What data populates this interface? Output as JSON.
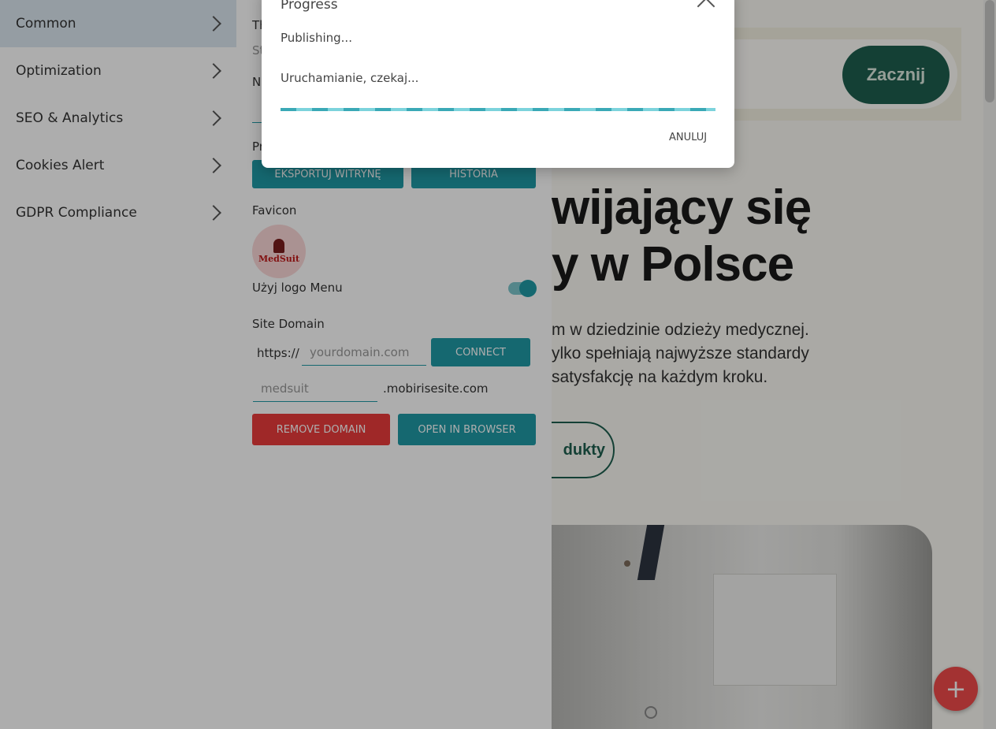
{
  "menu": {
    "items": [
      {
        "label": "Common"
      },
      {
        "label": "Optimization"
      },
      {
        "label": "SEO & Analytics"
      },
      {
        "label": "Cookies Alert"
      },
      {
        "label": "GDPR Compliance"
      }
    ]
  },
  "panel": {
    "partial_labels": [
      "Th",
      "St",
      "N",
      "Pr"
    ],
    "export_button": "EKSPORTUJ WITRYNĘ",
    "history_button": "HISTORIA",
    "favicon_label": "Favicon",
    "favicon_logo_text": "MedSuit",
    "use_logo_label": "Użyj logo Menu",
    "use_logo_enabled": true,
    "site_domain_label": "Site Domain",
    "https_prefix": "https://",
    "domain_placeholder": "yourdomain.com",
    "connect_button": "CONNECT",
    "subdomain_value": "medsuit",
    "subdomain_suffix": ".mobirisesite.com",
    "remove_domain_button": "REMOVE DOMAIN",
    "open_browser_button": "OPEN IN BROWSER"
  },
  "dialog": {
    "title": "Progress",
    "status": "Publishing...",
    "message": "Uruchamianie, czekaj...",
    "cancel_label": "ANULUJ"
  },
  "site": {
    "start_button": "Zacznij",
    "hero_line1": "wijający się",
    "hero_line2": "y w Polsce",
    "para_line1": "m w dziedzinie odzieży medycznej.",
    "para_line2": "ylko spełniają najwyższe standardy",
    "para_line3": "satysfakcję na każdym kroku.",
    "products_button": "dukty"
  },
  "fab": {
    "icon": "plus-icon",
    "symbol": "+"
  },
  "colors": {
    "accent": "#1f9aa6",
    "danger": "#ea3c3c",
    "site_green": "#1e5f4f"
  }
}
